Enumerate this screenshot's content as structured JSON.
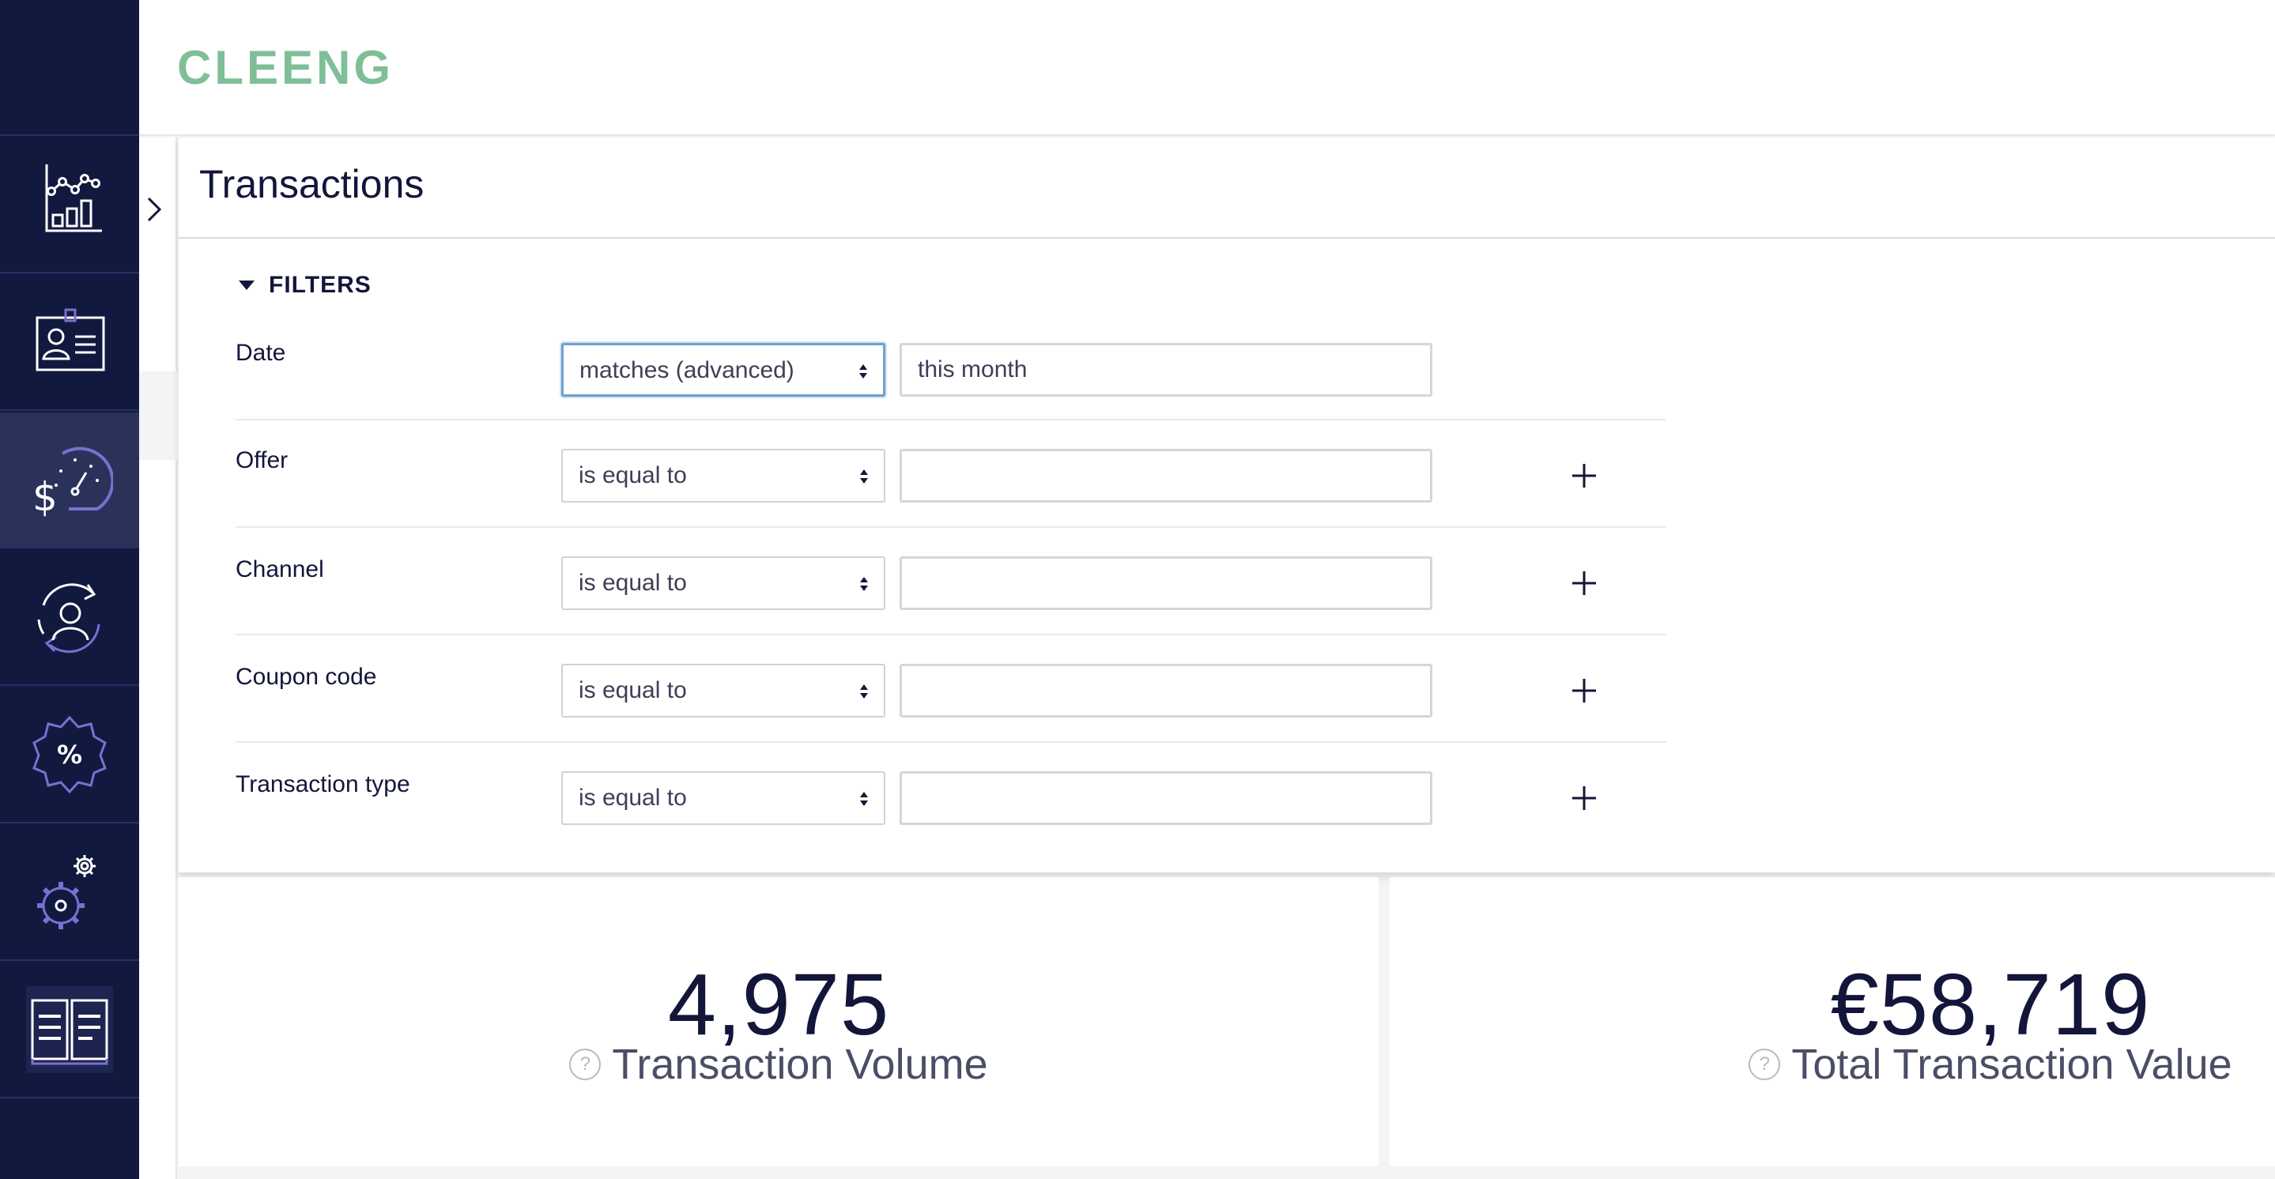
{
  "brand": {
    "name": "CLEENG",
    "logo_color": "#7fbf98"
  },
  "colors": {
    "sidebar_bg": "#12193f",
    "sidebar_active": "#2a3259",
    "accent_violet": "#7b6fd0",
    "text_dark": "#13163a",
    "focus_border": "#6fa0cf"
  },
  "sidebar": {
    "items": [
      {
        "icon": "analytics-chart-icon",
        "active": false
      },
      {
        "icon": "customer-id-card-icon",
        "active": false
      },
      {
        "icon": "revenue-gauge-icon",
        "active": true
      },
      {
        "icon": "customer-retention-icon",
        "active": false
      },
      {
        "icon": "discount-badge-icon",
        "active": false
      },
      {
        "icon": "settings-gears-icon",
        "active": false
      },
      {
        "icon": "documentation-book-icon",
        "active": false
      }
    ]
  },
  "page": {
    "title": "Transactions"
  },
  "filters": {
    "toggle_label": "FILTERS",
    "rows": [
      {
        "label": "Date",
        "operator": "matches (advanced)",
        "value": "this month",
        "add": false
      },
      {
        "label": "Offer",
        "operator": "is equal to",
        "value": "",
        "add": true
      },
      {
        "label": "Channel",
        "operator": "is equal to",
        "value": "",
        "add": true
      },
      {
        "label": "Coupon code",
        "operator": "is equal to",
        "value": "",
        "add": true
      },
      {
        "label": "Transaction type",
        "operator": "is equal to",
        "value": "",
        "add": true
      }
    ]
  },
  "stats": [
    {
      "value": "4,975",
      "label": "Transaction Volume",
      "help": "?"
    },
    {
      "value": "€58,719",
      "label": "Total Transaction Value",
      "help": "?"
    }
  ]
}
